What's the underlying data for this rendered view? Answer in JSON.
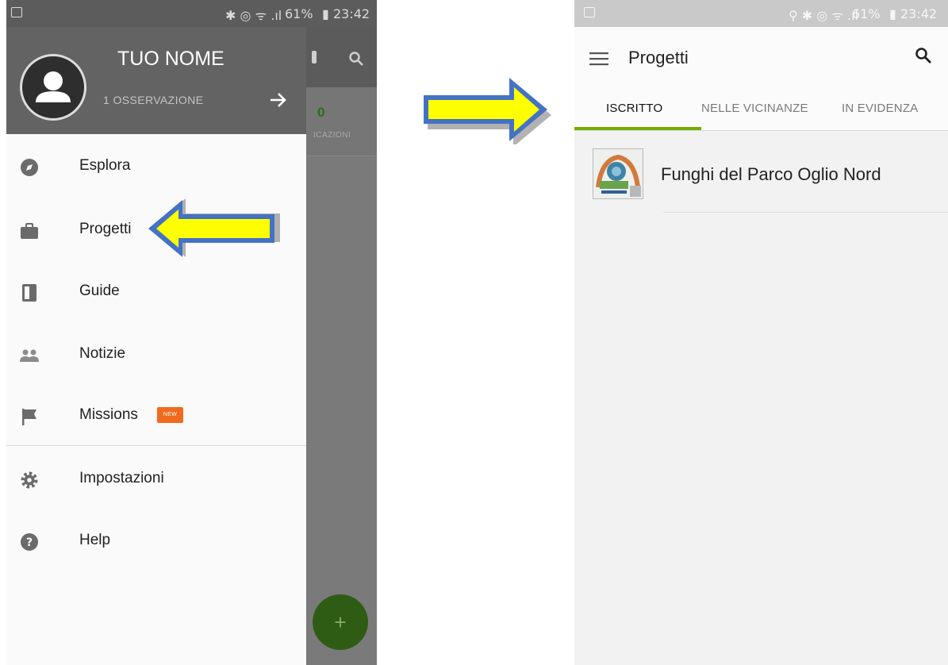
{
  "left_status": {
    "time": "23:42",
    "battery": "61%"
  },
  "right_status": {
    "time": "23:42",
    "battery": "61%"
  },
  "background_app": {
    "count": "0",
    "count_label": "ICAZIONI"
  },
  "drawer": {
    "user_name": "TUO NOME",
    "observations": "1 OSSERVAZIONE",
    "items": [
      {
        "label": "Esplora",
        "icon": "compass-icon"
      },
      {
        "label": "Progetti",
        "icon": "briefcase-icon"
      },
      {
        "label": "Guide",
        "icon": "book-icon"
      },
      {
        "label": "Notizie",
        "icon": "people-icon"
      },
      {
        "label": "Missions",
        "icon": "flag-icon",
        "badge": "NEW"
      },
      {
        "label": "Impostazioni",
        "icon": "gear-icon"
      },
      {
        "label": "Help",
        "icon": "help-icon"
      }
    ]
  },
  "projects_screen": {
    "title": "Progetti",
    "tabs": [
      "ISCRITTO",
      "NELLE VICINANZE",
      "IN EVIDENZA"
    ],
    "active_tab": "ISCRITTO",
    "projects": [
      {
        "name": "Funghi del Parco Oglio Nord"
      }
    ]
  },
  "colors": {
    "accent_green": "#74ac00",
    "badge_orange": "#f06b1f",
    "arrow_fill": "#ffff00",
    "arrow_border": "#4472c4"
  }
}
